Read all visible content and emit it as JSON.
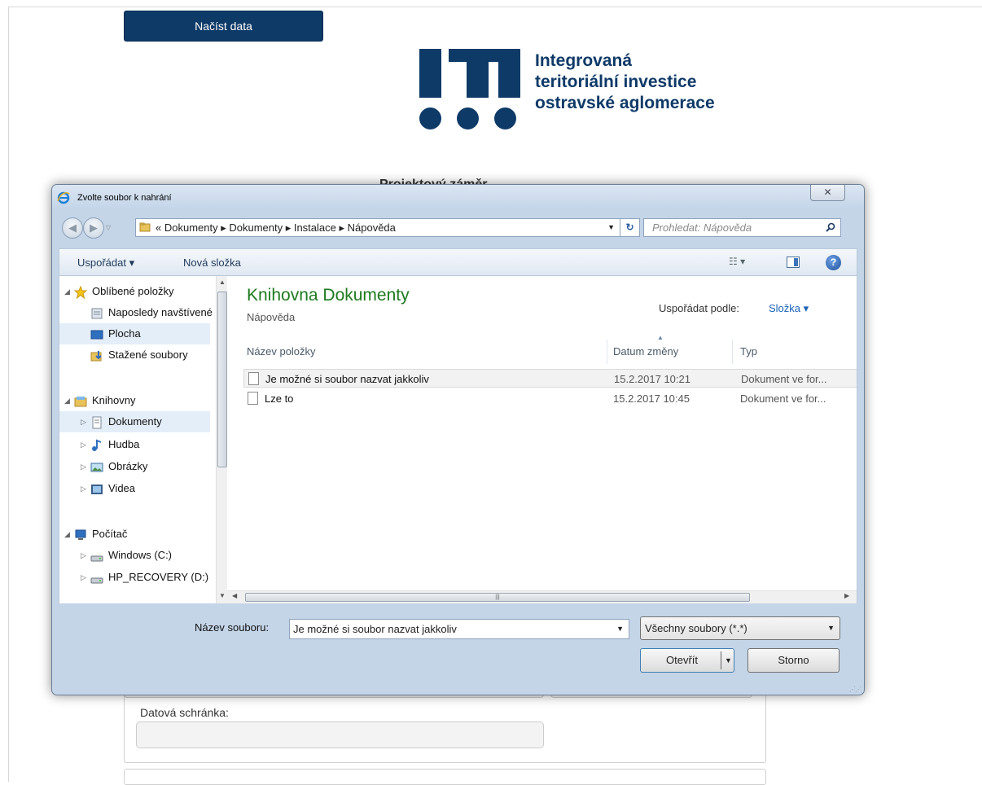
{
  "page": {
    "load_button": "Načíst data",
    "logo_lines": [
      "Integrovaná",
      "teritoriální investice",
      "ostravské aglomerace"
    ],
    "background_title": "Projektový záměr",
    "datova_label": "Datová schránka:"
  },
  "dialog": {
    "title": "Zvolte soubor k nahrání",
    "close_glyph": "✕",
    "address_path": "« Dokumenty ▸ Dokumenty ▸ Instalace ▸ Nápověda",
    "search_placeholder": "Prohledat: Nápověda",
    "toolbar": {
      "organize": "Uspořádat ▾",
      "new_folder": "Nová složka",
      "views": "☷ ▾",
      "help": "?"
    },
    "nav": [
      {
        "label": "Oblíbené položky",
        "icon": "star-icon",
        "level": 0,
        "arrow": "◢"
      },
      {
        "label": "Naposledy navštívené",
        "icon": "recent-places-icon",
        "level": 1
      },
      {
        "label": "Plocha",
        "icon": "desktop-icon",
        "level": 1,
        "selected": true
      },
      {
        "label": "Stažené soubory",
        "icon": "downloads-icon",
        "level": 1
      },
      {
        "label": "Knihovny",
        "icon": "libraries-icon",
        "level": 0,
        "arrow": "◢"
      },
      {
        "label": "Dokumenty",
        "icon": "documents-icon",
        "level": 1,
        "arrow": "▷",
        "selected": true
      },
      {
        "label": "Hudba",
        "icon": "music-icon",
        "level": 1,
        "arrow": "▷"
      },
      {
        "label": "Obrázky",
        "icon": "pictures-icon",
        "level": 1,
        "arrow": "▷"
      },
      {
        "label": "Videa",
        "icon": "videos-icon",
        "level": 1,
        "arrow": "▷"
      },
      {
        "label": "Počítač",
        "icon": "computer-icon",
        "level": 0,
        "arrow": "◢"
      },
      {
        "label": "Windows (C:)",
        "icon": "drive-icon",
        "level": 1,
        "arrow": "▷"
      },
      {
        "label": "HP_RECOVERY (D:)",
        "icon": "drive-icon",
        "level": 1,
        "arrow": "▷"
      }
    ],
    "library_title": "Knihovna Dokumenty",
    "library_subtitle": "Nápověda",
    "arrange_label": "Uspořádat podle:",
    "arrange_value": "Složka ▾",
    "columns": {
      "name": "Název položky",
      "date": "Datum změny",
      "type": "Typ"
    },
    "files": [
      {
        "name": "Je možné si soubor nazvat jakkoliv",
        "date": "15.2.2017 10:21",
        "type": "Dokument ve for...",
        "selected": true
      },
      {
        "name": "Lze to",
        "date": "15.2.2017 10:45",
        "type": "Dokument ve for..."
      }
    ],
    "filename_label": "Název souboru:",
    "filename_value": "Je možné si soubor nazvat jakkoliv",
    "filetype_value": "Všechny soubory (*.*)",
    "open_button": "Otevřít",
    "cancel_button": "Storno"
  },
  "colors": {
    "brand": "#0e3a68",
    "library_title": "#1e7a1e",
    "link": "#1a63b7"
  }
}
